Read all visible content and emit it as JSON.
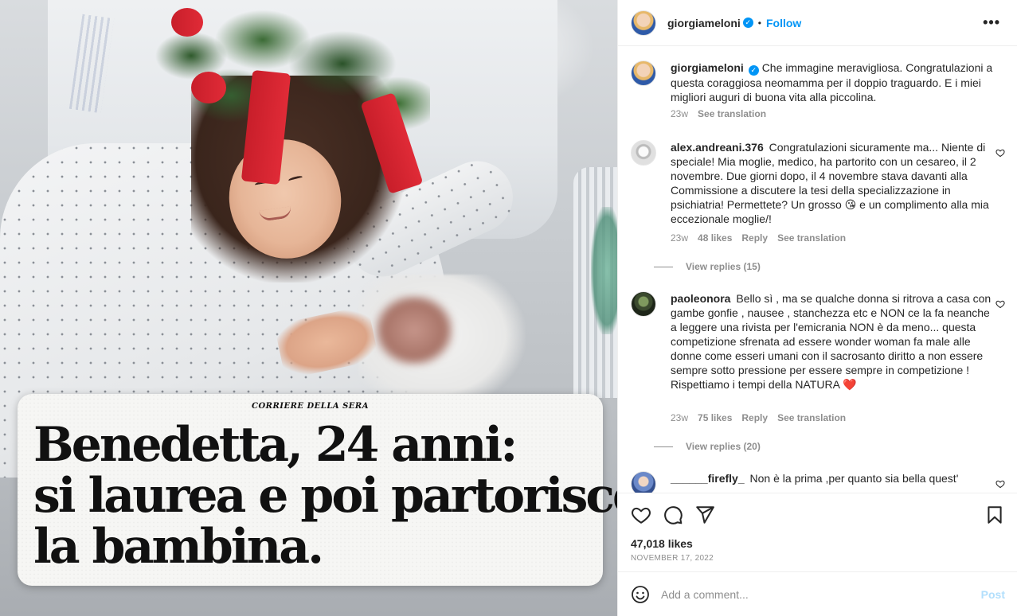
{
  "media": {
    "masthead": "CORRIERE DELLA SERA",
    "headline_lines": [
      "Benedetta, 24 anni:",
      "si laurea e poi partorisce",
      "la bambina."
    ]
  },
  "header": {
    "username": "giorgiameloni",
    "separator": "•",
    "follow_label": "Follow",
    "more_label": "•••"
  },
  "caption": {
    "username": "giorgiameloni",
    "text": "Che immagine meravigliosa. Congratulazioni a questa coraggiosa neomamma per il doppio traguardo. E i miei migliori auguri di buona vita alla piccolina.",
    "time": "23w",
    "see_translation": "See translation"
  },
  "comments": [
    {
      "username": "alex.andreani.376",
      "text": "Congratulazioni sicuramente ma... Niente di speciale! Mia moglie, medico, ha partorito con un cesareo, il 2 novembre. Due giorni dopo, il 4 novembre stava davanti alla Commissione a discutere la tesi della specializzazione in psichiatria! Permettete? Un grosso 😘 e un complimento alla mia eccezionale moglie/!",
      "time": "23w",
      "likes": "48 likes",
      "reply": "Reply",
      "see_translation": "See translation",
      "view_replies": "View replies (15)"
    },
    {
      "username": "paoleonora",
      "text": "Bello sì , ma se qualche donna si ritrova a casa con gambe gonfie , nausee , stanchezza etc e NON ce la fa neanche a leggere una rivista per l'emicrania NON è da meno... questa competizione sfrenata ad essere wonder woman fa male alle donne come esseri umani con il sacrosanto diritto a non essere sempre sotto pressione per essere sempre in competizione ! Rispettiamo i tempi della NATURA ❤️",
      "time": "23w",
      "likes": "75 likes",
      "reply": "Reply",
      "see_translation": "See translation",
      "view_replies": "View replies (20)"
    },
    {
      "username": "______firefly_",
      "text": "Non è la prima ,per quanto sia bella quest'"
    }
  ],
  "footer": {
    "likes": "47,018 likes",
    "date": "November 17, 2022",
    "add_comment_placeholder": "Add a comment...",
    "post_label": "Post"
  },
  "icons": {
    "like": "heart-icon",
    "comment": "comment-icon",
    "share": "share-icon",
    "save": "bookmark-icon",
    "emoji": "emoji-icon",
    "verified": "verified-badge-icon"
  },
  "colors": {
    "link_blue": "#0095f6",
    "muted": "#8e8e8e",
    "post_disabled": "#b2dffc"
  }
}
